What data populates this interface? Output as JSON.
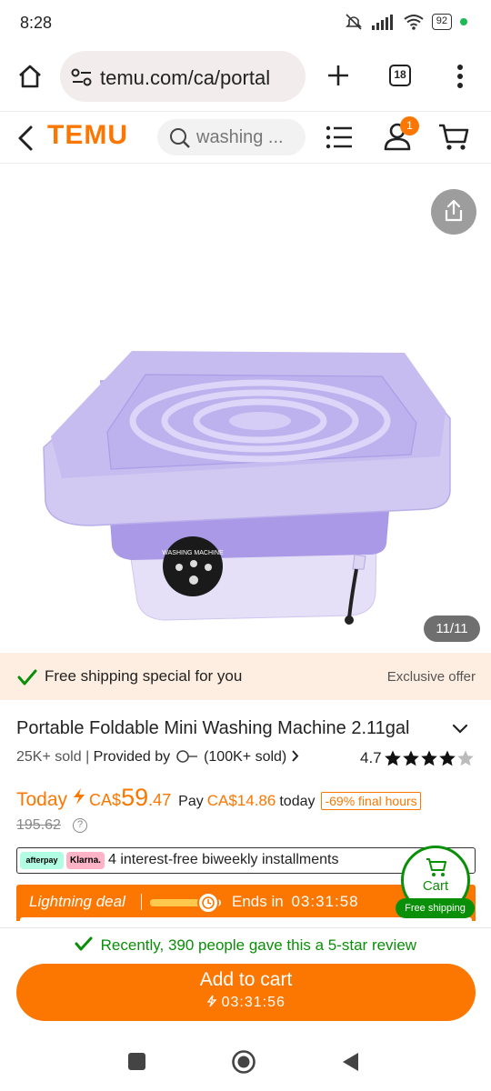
{
  "status_bar": {
    "time": "8:28",
    "battery": "92"
  },
  "browser": {
    "url": "temu.com/ca/portal",
    "tab_count": "18"
  },
  "header": {
    "logo": "TEMU",
    "search_placeholder": "washing ...",
    "notif_count": "1"
  },
  "gallery": {
    "counter": "11/11",
    "panel_text": "WASHING MACHINE"
  },
  "shipping": {
    "text": "Free shipping special for you",
    "offer": "Exclusive offer"
  },
  "product": {
    "title": "Portable Foldable Mini Washing Machine 2.11gal",
    "sold": "25K+ sold",
    "provided_by": "Provided by",
    "seller_sold": "(100K+ sold)",
    "rating": "4.7"
  },
  "pricing": {
    "today": "Today",
    "currency": "CA$",
    "price_int": "59",
    "price_dec": ".47",
    "pay_label": "Pay",
    "pay_amount": "CA$14.86",
    "pay_suffix": "today",
    "discount": "-69% final hours",
    "original": "195.62",
    "info": "?"
  },
  "installments": {
    "afterpay": "afterpay",
    "klarna": "Klarna.",
    "text": "4 interest-free biweekly installments"
  },
  "deal": {
    "label": "Lightning deal",
    "ends_label": "Ends in",
    "countdown": "03:31:58",
    "progress": 0.7
  },
  "cart_fab": {
    "label": "Cart",
    "free_shipping": "Free shipping"
  },
  "bottom": {
    "review_text": "Recently, 390 people gave this a 5-star review",
    "add_to_cart": "Add to cart",
    "countdown": "03:31:56"
  },
  "colors": {
    "brand": "#fb7701",
    "green": "#0a8f08",
    "machine": "#b6a8ec"
  }
}
